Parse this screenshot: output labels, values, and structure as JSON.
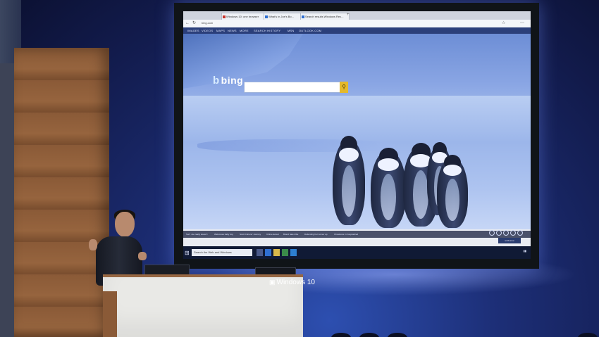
{
  "browser": {
    "tabs": [
      {
        "label": "Windows 10: one browser",
        "favicon_color": "#c8342b"
      },
      {
        "label": "What's in Joe's Bo...",
        "favicon_color": "#2f6fd1"
      },
      {
        "label": "Search results Windows Rec...",
        "favicon_color": "#2f6fd1"
      }
    ],
    "address": "bing.com",
    "nav_links": [
      "IMAGES",
      "VIDEOS",
      "MAPS",
      "NEWS",
      "MORE",
      "SEARCH HISTORY",
      "MSN",
      "OUTLOOK.COM"
    ]
  },
  "bing": {
    "logo_text": "bing",
    "logo_mark": "b"
  },
  "ticker_items": [
    "Surf: Joe really doesn't",
    "Welcomes baby boy",
    "Scott Cohens' Journey",
    "China denied",
    "Brand hate tribe",
    "Defending her runner up",
    "Chowbone in hospitalized"
  ],
  "taskbar": {
    "search_placeholder": "Search the Web and Windows",
    "notification": "notification"
  },
  "podium": {
    "logo_text": "Windows 10",
    "logo_icon": "windows-logo-icon"
  },
  "colors": {
    "stage_blue": "#1d2f78",
    "bing_search_button": "#e4b92c",
    "wood": "#8a5a37"
  }
}
